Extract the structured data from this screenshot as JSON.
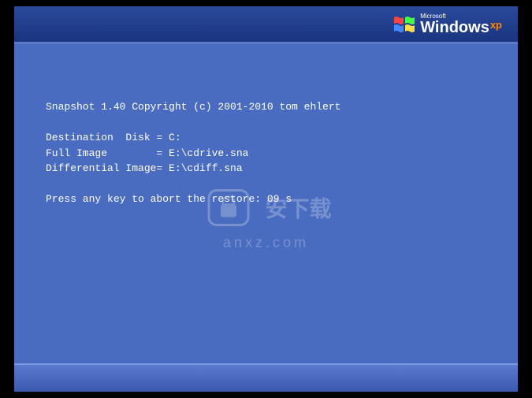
{
  "branding": {
    "microsoft": "Microsoft",
    "windows": "Windows",
    "xp": "xp"
  },
  "console": {
    "copyright": "Snapshot 1.40 Copyright (c) 2001-2010 tom ehlert",
    "destination": "Destination  Disk = C:",
    "full_image": "Full Image        = E:\\cdrive.sna",
    "diff_image": "Differential Image= E:\\cdiff.sna",
    "prompt": "Press any key to abort the restore: 09 s"
  },
  "watermark": {
    "text_cn": "安下载",
    "text_en": "anxz.com"
  }
}
